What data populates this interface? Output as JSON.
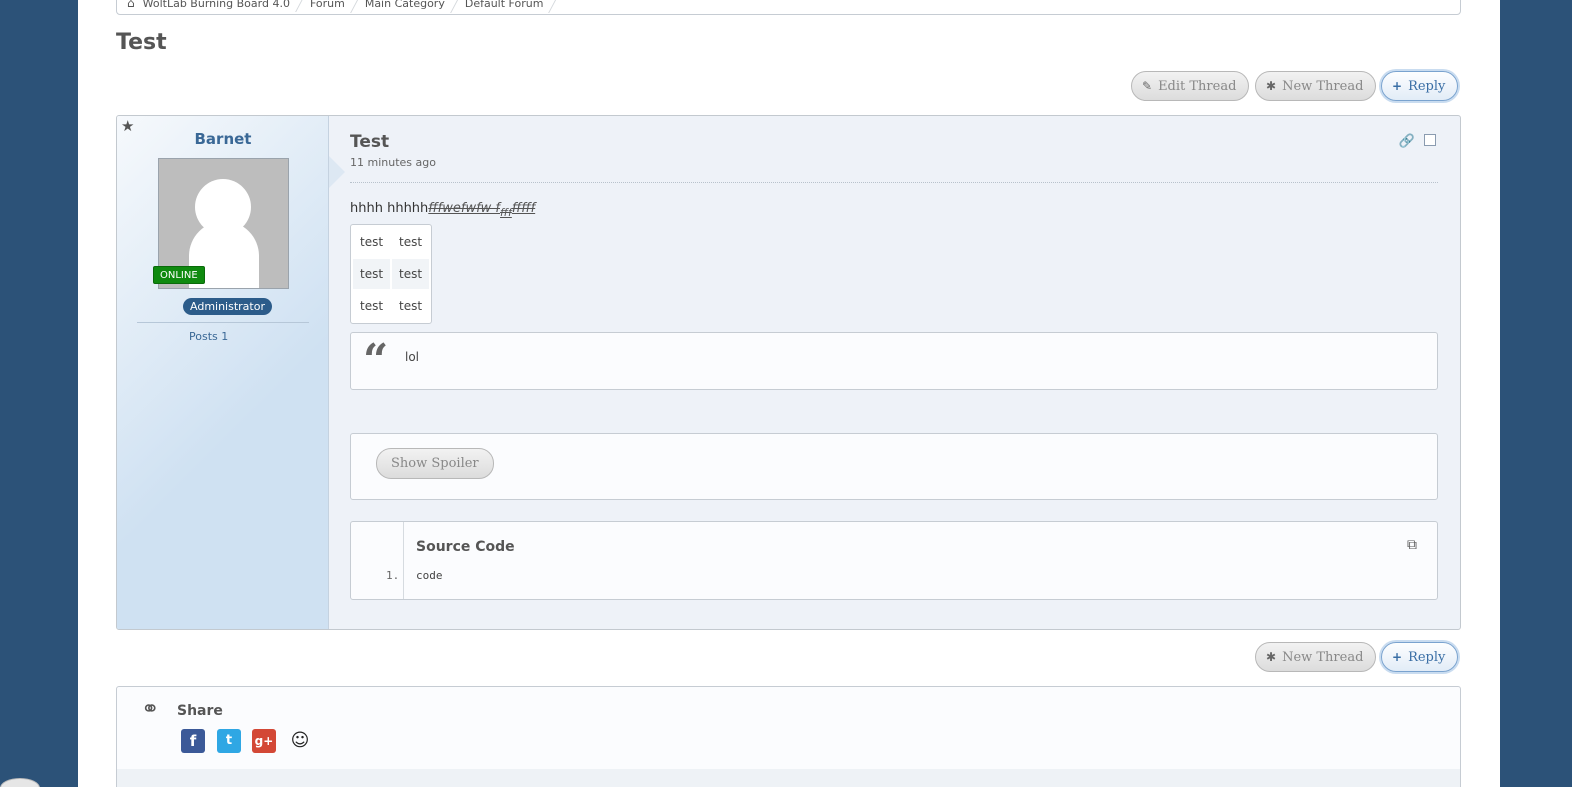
{
  "breadcrumb": [
    "WoltLab Burning Board 4.0",
    "Forum",
    "Main Category",
    "Default Forum"
  ],
  "page_title": "Test",
  "toolbar": {
    "edit_thread": "Edit Thread",
    "new_thread": "New Thread",
    "reply": "Reply"
  },
  "post": {
    "author": "Barnet",
    "online": "ONLINE",
    "role": "Administrator",
    "posts_stat": "Posts 1",
    "title": "Test",
    "time": "11 minutes ago",
    "body_plain": "hhhh hhhhh",
    "body_styled": "fffwefwfw f",
    "body_sub": "fff",
    "body_tail": "fffff",
    "table": [
      [
        "test",
        "test"
      ],
      [
        "test",
        "test"
      ],
      [
        "test",
        "test"
      ]
    ],
    "quote": "lol",
    "spoiler_button": "Show Spoiler",
    "code_title": "Source Code",
    "code_line_num": "1.",
    "code_line": "code"
  },
  "share": {
    "label": "Share",
    "networks": [
      "facebook",
      "twitter",
      "google-plus",
      "reddit"
    ]
  },
  "colors": {
    "background": "#2c5278",
    "accent": "#3a6ea5",
    "online": "#0f8a0f"
  }
}
